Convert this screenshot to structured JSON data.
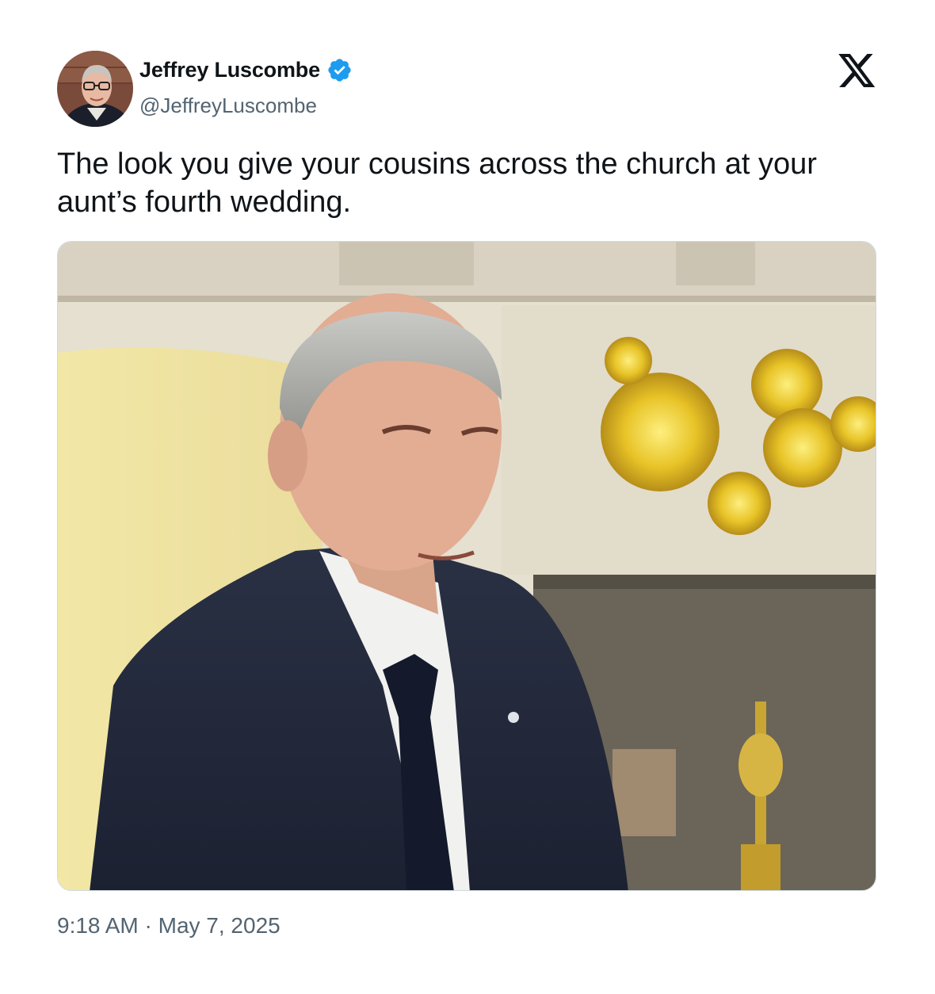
{
  "author": {
    "display_name": "Jeffrey Luscombe",
    "handle": "@JeffreyLuscombe",
    "verified": true,
    "verified_color": "#1d9bf0"
  },
  "tweet": {
    "text": "The look you give your cousins across the church at your\naunt’s fourth wedding."
  },
  "meta": {
    "timestamp": "9:18 AM · May 7, 2025"
  },
  "icons": {
    "brand": "x-logo-icon",
    "verified": "verified-badge-icon"
  },
  "colors": {
    "text_primary": "#0f1419",
    "text_secondary": "#536471",
    "border": "#cfd9de"
  }
}
